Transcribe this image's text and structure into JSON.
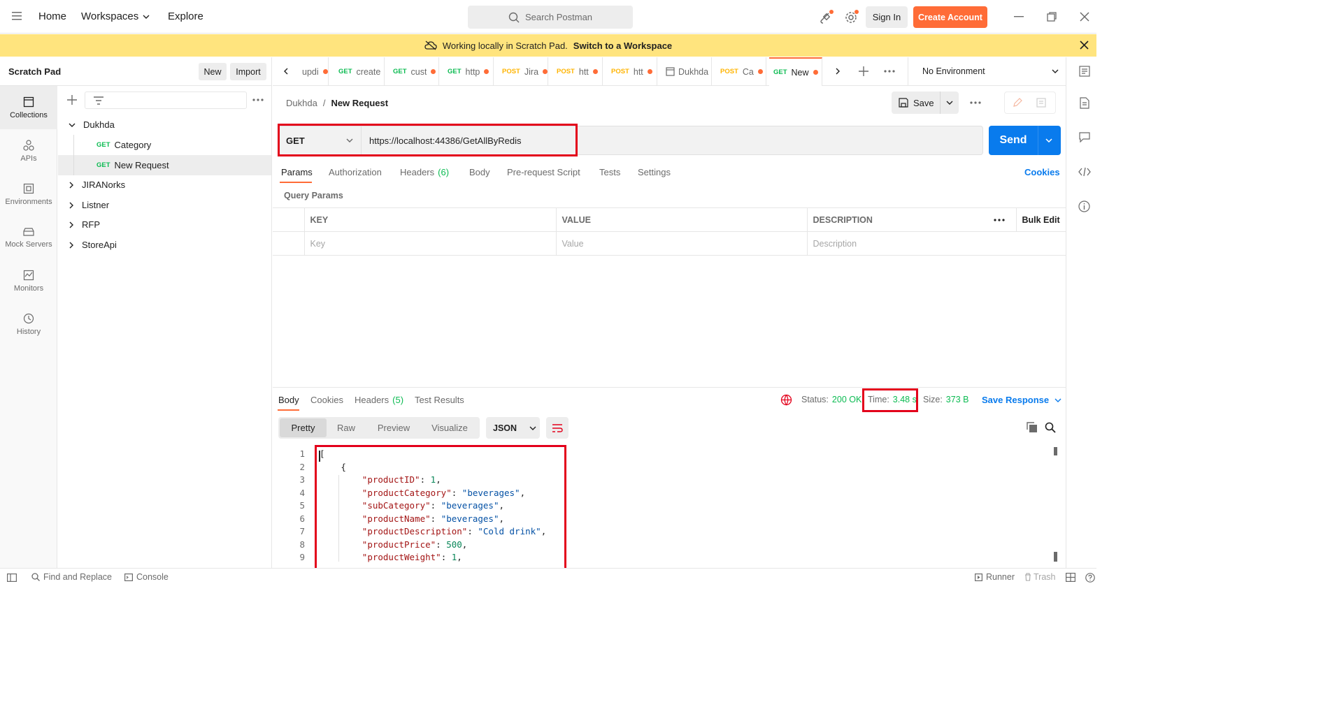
{
  "topbar": {
    "nav": [
      "Home",
      "Workspaces",
      "Explore"
    ],
    "search_placeholder": "Search Postman",
    "signin": "Sign In",
    "create_account": "Create Account"
  },
  "banner": {
    "text": "Working locally in Scratch Pad.",
    "link": "Switch to a Workspace"
  },
  "sidebar": {
    "title": "Scratch Pad",
    "new_label": "New",
    "import_label": "Import",
    "rail": [
      "Collections",
      "APIs",
      "Environments",
      "Mock Servers",
      "Monitors",
      "History"
    ],
    "tree": [
      {
        "label": "Dukhda",
        "type": "folder"
      },
      {
        "label": "Category",
        "method": "GET"
      },
      {
        "label": "New Request",
        "method": "GET"
      },
      {
        "label": "JIRANorks",
        "type": "folder"
      },
      {
        "label": "Listner",
        "type": "folder"
      },
      {
        "label": "RFP",
        "type": "folder"
      },
      {
        "label": "StoreApi",
        "type": "folder"
      }
    ]
  },
  "tabs": [
    {
      "method": "",
      "label": "updi"
    },
    {
      "method": "GET",
      "label": "create"
    },
    {
      "method": "GET",
      "label": "cust"
    },
    {
      "method": "GET",
      "label": "http"
    },
    {
      "method": "POST",
      "label": "Jira"
    },
    {
      "method": "POST",
      "label": "htt"
    },
    {
      "method": "POST",
      "label": "htt"
    },
    {
      "method": "",
      "label": "Dukhda"
    },
    {
      "method": "POST",
      "label": "Ca"
    },
    {
      "method": "GET",
      "label": "New"
    }
  ],
  "environment": "No Environment",
  "breadcrumb": {
    "parent": "Dukhda",
    "current": "New Request"
  },
  "save_label": "Save",
  "request": {
    "method": "GET",
    "url": "https://localhost:44386/GetAllByRedis",
    "send": "Send",
    "subtabs": [
      "Params",
      "Authorization",
      "Headers",
      "(6)",
      "Body",
      "Pre-request Script",
      "Tests",
      "Settings"
    ],
    "cookies": "Cookies",
    "query_params_title": "Query Params",
    "columns": [
      "KEY",
      "VALUE",
      "DESCRIPTION"
    ],
    "bulk_edit": "Bulk Edit",
    "placeholders": [
      "Key",
      "Value",
      "Description"
    ]
  },
  "response": {
    "tabs": [
      "Body",
      "Cookies",
      "Headers",
      "(5)",
      "Test Results"
    ],
    "status_label": "Status:",
    "status_value": "200 OK",
    "time_label": "Time:",
    "time_value": "3.48 s",
    "size_label": "Size:",
    "size_value": "373 B",
    "save_response": "Save Response",
    "views": [
      "Pretty",
      "Raw",
      "Preview",
      "Visualize"
    ],
    "format": "JSON",
    "lines": [
      {
        "n": "1",
        "indent": 0,
        "key": "",
        "val": "[",
        "vtype": "p",
        "tail": ""
      },
      {
        "n": "2",
        "indent": 4,
        "key": "",
        "val": "{",
        "vtype": "p",
        "tail": ""
      },
      {
        "n": "3",
        "indent": 8,
        "key": "\"productID\"",
        "val": "1",
        "vtype": "n",
        "tail": ","
      },
      {
        "n": "4",
        "indent": 8,
        "key": "\"productCategory\"",
        "val": "\"beverages\"",
        "vtype": "s",
        "tail": ","
      },
      {
        "n": "5",
        "indent": 8,
        "key": "\"subCategory\"",
        "val": "\"beverages\"",
        "vtype": "s",
        "tail": ","
      },
      {
        "n": "6",
        "indent": 8,
        "key": "\"productName\"",
        "val": "\"beverages\"",
        "vtype": "s",
        "tail": ","
      },
      {
        "n": "7",
        "indent": 8,
        "key": "\"productDescription\"",
        "val": "\"Cold drink\"",
        "vtype": "s",
        "tail": ","
      },
      {
        "n": "8",
        "indent": 8,
        "key": "\"productPrice\"",
        "val": "500",
        "vtype": "n",
        "tail": ","
      },
      {
        "n": "9",
        "indent": 8,
        "key": "\"productWeight\"",
        "val": "1",
        "vtype": "n",
        "tail": ","
      }
    ]
  },
  "footer": {
    "find_replace": "Find and Replace",
    "console": "Console",
    "runner": "Runner",
    "trash": "Trash"
  },
  "colors": {
    "accent": "#ff6c37",
    "send": "#097bed",
    "banner": "#ffe47e",
    "get": "#0cbb52",
    "post": "#ffb400",
    "highlight": "#e3001b"
  },
  "icons": [
    "hamburger-icon",
    "chevron-down-icon",
    "search-icon",
    "satellite-icon",
    "gear-icon",
    "minimize-icon",
    "restore-icon",
    "close-icon",
    "cloud-off-icon",
    "collections-icon",
    "apis-icon",
    "environments-icon",
    "mock-servers-icon",
    "monitors-icon",
    "history-icon",
    "plus-icon",
    "filter-icon",
    "more-icon",
    "chevron-right-icon",
    "save-icon",
    "edit-icon",
    "comment-icon",
    "docs-icon",
    "code-icon",
    "info-icon",
    "globe-icon",
    "wrap-icon",
    "copy-icon"
  ]
}
